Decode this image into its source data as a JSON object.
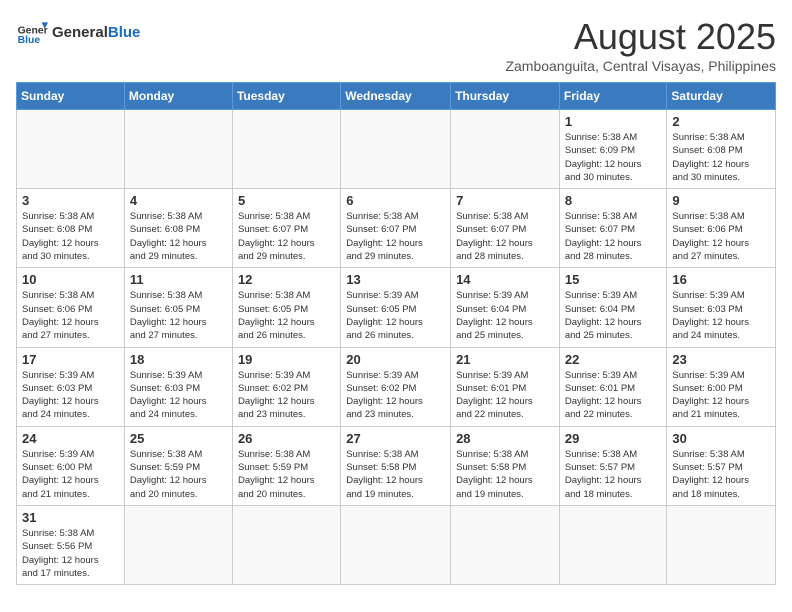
{
  "header": {
    "logo_general": "General",
    "logo_blue": "Blue",
    "month_year": "August 2025",
    "location": "Zamboanguita, Central Visayas, Philippines"
  },
  "days_of_week": [
    "Sunday",
    "Monday",
    "Tuesday",
    "Wednesday",
    "Thursday",
    "Friday",
    "Saturday"
  ],
  "weeks": [
    [
      {
        "day": null,
        "info": null
      },
      {
        "day": null,
        "info": null
      },
      {
        "day": null,
        "info": null
      },
      {
        "day": null,
        "info": null
      },
      {
        "day": null,
        "info": null
      },
      {
        "day": "1",
        "info": "Sunrise: 5:38 AM\nSunset: 6:09 PM\nDaylight: 12 hours\nand 30 minutes."
      },
      {
        "day": "2",
        "info": "Sunrise: 5:38 AM\nSunset: 6:08 PM\nDaylight: 12 hours\nand 30 minutes."
      }
    ],
    [
      {
        "day": "3",
        "info": "Sunrise: 5:38 AM\nSunset: 6:08 PM\nDaylight: 12 hours\nand 30 minutes."
      },
      {
        "day": "4",
        "info": "Sunrise: 5:38 AM\nSunset: 6:08 PM\nDaylight: 12 hours\nand 29 minutes."
      },
      {
        "day": "5",
        "info": "Sunrise: 5:38 AM\nSunset: 6:07 PM\nDaylight: 12 hours\nand 29 minutes."
      },
      {
        "day": "6",
        "info": "Sunrise: 5:38 AM\nSunset: 6:07 PM\nDaylight: 12 hours\nand 29 minutes."
      },
      {
        "day": "7",
        "info": "Sunrise: 5:38 AM\nSunset: 6:07 PM\nDaylight: 12 hours\nand 28 minutes."
      },
      {
        "day": "8",
        "info": "Sunrise: 5:38 AM\nSunset: 6:07 PM\nDaylight: 12 hours\nand 28 minutes."
      },
      {
        "day": "9",
        "info": "Sunrise: 5:38 AM\nSunset: 6:06 PM\nDaylight: 12 hours\nand 27 minutes."
      }
    ],
    [
      {
        "day": "10",
        "info": "Sunrise: 5:38 AM\nSunset: 6:06 PM\nDaylight: 12 hours\nand 27 minutes."
      },
      {
        "day": "11",
        "info": "Sunrise: 5:38 AM\nSunset: 6:05 PM\nDaylight: 12 hours\nand 27 minutes."
      },
      {
        "day": "12",
        "info": "Sunrise: 5:38 AM\nSunset: 6:05 PM\nDaylight: 12 hours\nand 26 minutes."
      },
      {
        "day": "13",
        "info": "Sunrise: 5:39 AM\nSunset: 6:05 PM\nDaylight: 12 hours\nand 26 minutes."
      },
      {
        "day": "14",
        "info": "Sunrise: 5:39 AM\nSunset: 6:04 PM\nDaylight: 12 hours\nand 25 minutes."
      },
      {
        "day": "15",
        "info": "Sunrise: 5:39 AM\nSunset: 6:04 PM\nDaylight: 12 hours\nand 25 minutes."
      },
      {
        "day": "16",
        "info": "Sunrise: 5:39 AM\nSunset: 6:03 PM\nDaylight: 12 hours\nand 24 minutes."
      }
    ],
    [
      {
        "day": "17",
        "info": "Sunrise: 5:39 AM\nSunset: 6:03 PM\nDaylight: 12 hours\nand 24 minutes."
      },
      {
        "day": "18",
        "info": "Sunrise: 5:39 AM\nSunset: 6:03 PM\nDaylight: 12 hours\nand 24 minutes."
      },
      {
        "day": "19",
        "info": "Sunrise: 5:39 AM\nSunset: 6:02 PM\nDaylight: 12 hours\nand 23 minutes."
      },
      {
        "day": "20",
        "info": "Sunrise: 5:39 AM\nSunset: 6:02 PM\nDaylight: 12 hours\nand 23 minutes."
      },
      {
        "day": "21",
        "info": "Sunrise: 5:39 AM\nSunset: 6:01 PM\nDaylight: 12 hours\nand 22 minutes."
      },
      {
        "day": "22",
        "info": "Sunrise: 5:39 AM\nSunset: 6:01 PM\nDaylight: 12 hours\nand 22 minutes."
      },
      {
        "day": "23",
        "info": "Sunrise: 5:39 AM\nSunset: 6:00 PM\nDaylight: 12 hours\nand 21 minutes."
      }
    ],
    [
      {
        "day": "24",
        "info": "Sunrise: 5:39 AM\nSunset: 6:00 PM\nDaylight: 12 hours\nand 21 minutes."
      },
      {
        "day": "25",
        "info": "Sunrise: 5:38 AM\nSunset: 5:59 PM\nDaylight: 12 hours\nand 20 minutes."
      },
      {
        "day": "26",
        "info": "Sunrise: 5:38 AM\nSunset: 5:59 PM\nDaylight: 12 hours\nand 20 minutes."
      },
      {
        "day": "27",
        "info": "Sunrise: 5:38 AM\nSunset: 5:58 PM\nDaylight: 12 hours\nand 19 minutes."
      },
      {
        "day": "28",
        "info": "Sunrise: 5:38 AM\nSunset: 5:58 PM\nDaylight: 12 hours\nand 19 minutes."
      },
      {
        "day": "29",
        "info": "Sunrise: 5:38 AM\nSunset: 5:57 PM\nDaylight: 12 hours\nand 18 minutes."
      },
      {
        "day": "30",
        "info": "Sunrise: 5:38 AM\nSunset: 5:57 PM\nDaylight: 12 hours\nand 18 minutes."
      }
    ],
    [
      {
        "day": "31",
        "info": "Sunrise: 5:38 AM\nSunset: 5:56 PM\nDaylight: 12 hours\nand 17 minutes."
      },
      {
        "day": null,
        "info": null
      },
      {
        "day": null,
        "info": null
      },
      {
        "day": null,
        "info": null
      },
      {
        "day": null,
        "info": null
      },
      {
        "day": null,
        "info": null
      },
      {
        "day": null,
        "info": null
      }
    ]
  ]
}
